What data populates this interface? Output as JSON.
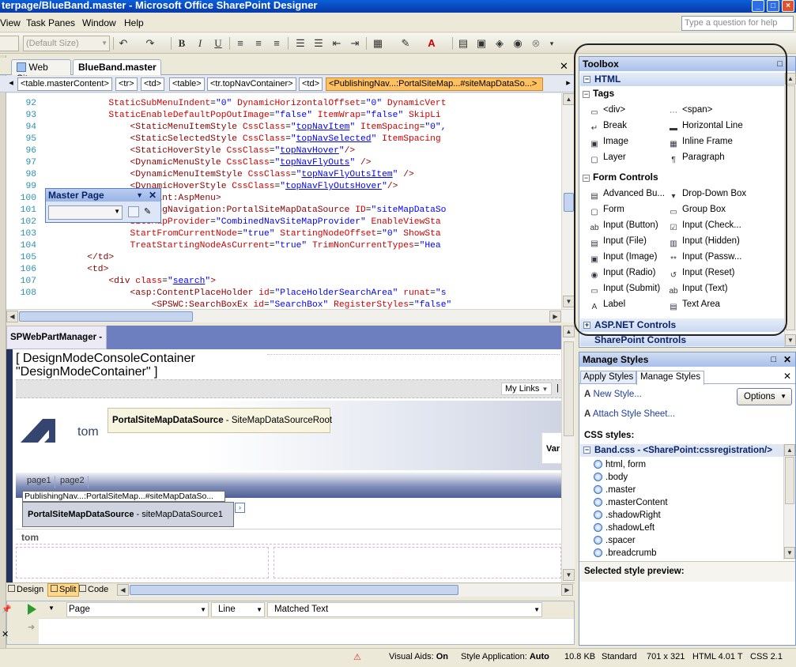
{
  "window": {
    "title": "terpage/BlueBand.master - Microsoft Office SharePoint Designer",
    "controls": [
      "minimize-icon",
      "maximize-icon",
      "close-icon"
    ]
  },
  "menu": {
    "items": [
      "View",
      "Task Panes",
      "Window",
      "Help"
    ],
    "help_placeholder": "Type a question for help"
  },
  "toolbar": {
    "font_size": "(Default Size)"
  },
  "doc_tabs": [
    "Web Site",
    "BlueBand.master"
  ],
  "breadcrumb": [
    "<table.masterContent>",
    "<tr>",
    "<td>",
    "<table>",
    "<tr.topNavContainer>",
    "<td>",
    "<PublishingNav...:PortalSiteMap...#siteMapDataSo...>"
  ],
  "code": {
    "line_numbers": [
      "92",
      "93",
      "94",
      "95",
      "96",
      "97",
      "98",
      "99",
      "100",
      "101",
      "102",
      "103",
      "104",
      "105",
      "106",
      "107",
      "108"
    ],
    "lines": [
      [
        {
          "c": "at",
          "t": "            StaticSubMenuIndent"
        },
        {
          "c": "tx",
          "t": "="
        },
        {
          "c": "vl",
          "t": "\"0\""
        },
        {
          "c": "at",
          "t": " DynamicHorizontalOffset"
        },
        {
          "c": "tx",
          "t": "="
        },
        {
          "c": "vl",
          "t": "\"0\""
        },
        {
          "c": "at",
          "t": " DynamicVert"
        }
      ],
      [
        {
          "c": "at",
          "t": "            StaticEnableDefaultPopOutImage"
        },
        {
          "c": "tx",
          "t": "="
        },
        {
          "c": "vl",
          "t": "\"false\""
        },
        {
          "c": "at",
          "t": " ItemWrap"
        },
        {
          "c": "tx",
          "t": "="
        },
        {
          "c": "vl",
          "t": "\"false\""
        },
        {
          "c": "at",
          "t": " SkipLi"
        }
      ],
      [
        {
          "c": "tg",
          "t": "                <StaticMenuItemStyle"
        },
        {
          "c": "at",
          "t": " CssClass"
        },
        {
          "c": "tx",
          "t": "="
        },
        {
          "c": "vl",
          "t": "\""
        },
        {
          "c": "st",
          "t": "topNavItem"
        },
        {
          "c": "vl",
          "t": "\""
        },
        {
          "c": "at",
          "t": " ItemSpacing"
        },
        {
          "c": "tx",
          "t": "="
        },
        {
          "c": "vl",
          "t": "\"0\","
        }
      ],
      [
        {
          "c": "tg",
          "t": "                <StaticSelectedStyle"
        },
        {
          "c": "at",
          "t": " CssClass"
        },
        {
          "c": "tx",
          "t": "="
        },
        {
          "c": "vl",
          "t": "\""
        },
        {
          "c": "st",
          "t": "topNavSelected"
        },
        {
          "c": "vl",
          "t": "\""
        },
        {
          "c": "at",
          "t": " ItemSpacing"
        }
      ],
      [
        {
          "c": "tg",
          "t": "                <StaticHoverStyle"
        },
        {
          "c": "at",
          "t": " CssClass"
        },
        {
          "c": "tx",
          "t": "="
        },
        {
          "c": "vl",
          "t": "\""
        },
        {
          "c": "st",
          "t": "topNavHover"
        },
        {
          "c": "vl",
          "t": "\""
        },
        {
          "c": "tg",
          "t": "/>"
        }
      ],
      [
        {
          "c": "tg",
          "t": "                <DynamicMenuStyle"
        },
        {
          "c": "at",
          "t": " CssClass"
        },
        {
          "c": "tx",
          "t": "="
        },
        {
          "c": "vl",
          "t": "\""
        },
        {
          "c": "st",
          "t": "topNavFlyOuts"
        },
        {
          "c": "vl",
          "t": "\""
        },
        {
          "c": "tg",
          "t": " />"
        }
      ],
      [
        {
          "c": "tg",
          "t": "                <DynamicMenuItemStyle"
        },
        {
          "c": "at",
          "t": " CssClass"
        },
        {
          "c": "tx",
          "t": "="
        },
        {
          "c": "vl",
          "t": "\""
        },
        {
          "c": "st",
          "t": "topNavFlyOutsItem"
        },
        {
          "c": "vl",
          "t": "\""
        },
        {
          "c": "tg",
          "t": " />"
        }
      ],
      [
        {
          "c": "tg",
          "t": "                <DynamicHoverStyle"
        },
        {
          "c": "at",
          "t": " CssClass"
        },
        {
          "c": "tx",
          "t": "="
        },
        {
          "c": "vl",
          "t": "\""
        },
        {
          "c": "st",
          "t": "topNavFlyOutsHover"
        },
        {
          "c": "vl",
          "t": "\""
        },
        {
          "c": "tg",
          "t": "/>"
        }
      ],
      [
        {
          "c": "tg",
          "t": "            </SharePoint:AspMenu>"
        }
      ],
      [
        {
          "c": "tg",
          "t": "            <PublishingNavigation:PortalSiteMapDataSource"
        },
        {
          "c": "at",
          "t": " ID"
        },
        {
          "c": "tx",
          "t": "="
        },
        {
          "c": "vl",
          "t": "\"siteMapDataSo"
        }
      ],
      [
        {
          "c": "at",
          "t": "                SiteMapProvider"
        },
        {
          "c": "tx",
          "t": "="
        },
        {
          "c": "vl",
          "t": "\"CombinedNavSiteMapProvider\""
        },
        {
          "c": "at",
          "t": " EnableViewSta"
        }
      ],
      [
        {
          "c": "at",
          "t": "                StartFromCurrentNode"
        },
        {
          "c": "tx",
          "t": "="
        },
        {
          "c": "vl",
          "t": "\"true\""
        },
        {
          "c": "at",
          "t": " StartingNodeOffset"
        },
        {
          "c": "tx",
          "t": "="
        },
        {
          "c": "vl",
          "t": "\"0\""
        },
        {
          "c": "at",
          "t": " ShowSta"
        }
      ],
      [
        {
          "c": "at",
          "t": "                TreatStartingNodeAsCurrent"
        },
        {
          "c": "tx",
          "t": "="
        },
        {
          "c": "vl",
          "t": "\"true\""
        },
        {
          "c": "at",
          "t": " TrimNonCurrentTypes"
        },
        {
          "c": "tx",
          "t": "="
        },
        {
          "c": "vl",
          "t": "\"Hea"
        }
      ],
      [
        {
          "c": "tg",
          "t": "        </td>"
        }
      ],
      [
        {
          "c": "tg",
          "t": "        <td>"
        }
      ],
      [
        {
          "c": "tg",
          "t": "            <div"
        },
        {
          "c": "at",
          "t": " class"
        },
        {
          "c": "tx",
          "t": "="
        },
        {
          "c": "vl",
          "t": "\""
        },
        {
          "c": "st",
          "t": "search"
        },
        {
          "c": "vl",
          "t": "\""
        },
        {
          "c": "tg",
          "t": ">"
        }
      ],
      [
        {
          "c": "tg",
          "t": "                <asp:ContentPlaceHolder"
        },
        {
          "c": "at",
          "t": " id"
        },
        {
          "c": "tx",
          "t": "="
        },
        {
          "c": "vl",
          "t": "\"PlaceHolderSearchArea\""
        },
        {
          "c": "at",
          "t": " runat"
        },
        {
          "c": "tx",
          "t": "="
        },
        {
          "c": "vl",
          "t": "\"s"
        }
      ],
      [
        {
          "c": "tg",
          "t": "                    <SPSWC:SearchBoxEx"
        },
        {
          "c": "at",
          "t": " id"
        },
        {
          "c": "tx",
          "t": "="
        },
        {
          "c": "vl",
          "t": "\"SearchBox\""
        },
        {
          "c": "at",
          "t": " RegisterStyles"
        },
        {
          "c": "tx",
          "t": "="
        },
        {
          "c": "vl",
          "t": "\"false\""
        }
      ]
    ]
  },
  "master_panel": {
    "title": "Master Page"
  },
  "design": {
    "webpartmanager": "SPWebPartManager -",
    "console_line1": "[ DesignModeConsoleContainer",
    "console_line2": "\"DesignModeContainer\" ]",
    "my_links": "My Links",
    "my_links_sep": "|",
    "sitemap_root_bold": "PortalSiteMapDataSource",
    "sitemap_root_rest": " - SiteMapDataSourceRoot",
    "logo_text": "tom",
    "va_label": "Var",
    "tabs": [
      "page1",
      "page2"
    ],
    "publishing_label": "PublishingNav...:PortalSiteMap...#siteMapDataSo...",
    "sitemap1_bold": "PortalSiteMapDataSource",
    "sitemap1_rest": " - siteMapDataSource1",
    "crumb_tom": "tom"
  },
  "view_tabs": [
    "Design",
    "Split",
    "Code"
  ],
  "find": {
    "columns": [
      "Page",
      "Line",
      "Matched Text"
    ]
  },
  "status": {
    "visual_aids_label": "Visual Aids:",
    "visual_aids_value": "On",
    "style_app_label": "Style Application:",
    "style_app_value": "Auto",
    "size": "10.8 KB",
    "mode": "Standard",
    "dimensions": "701 x 321",
    "doctype": "HTML 4.01 T",
    "css": "CSS 2.1"
  },
  "toolbox": {
    "title": "Toolbox",
    "section_html": "HTML",
    "group_tags": "Tags",
    "tags": [
      {
        "label": "<div>",
        "icon": "div-icon"
      },
      {
        "label": "<span>",
        "icon": "span-icon"
      },
      {
        "label": "Break",
        "icon": "break-icon"
      },
      {
        "label": "Horizontal Line",
        "icon": "hr-icon"
      },
      {
        "label": "Image",
        "icon": "image-icon"
      },
      {
        "label": "Inline Frame",
        "icon": "iframe-icon"
      },
      {
        "label": "Layer",
        "icon": "layer-icon"
      },
      {
        "label": "Paragraph",
        "icon": "paragraph-icon"
      }
    ],
    "group_forms": "Form Controls",
    "forms": [
      {
        "label": "Advanced Bu...",
        "icon": "advanced-button-icon"
      },
      {
        "label": "Drop-Down Box",
        "icon": "dropdown-icon"
      },
      {
        "label": "Form",
        "icon": "form-icon"
      },
      {
        "label": "Group Box",
        "icon": "groupbox-icon"
      },
      {
        "label": "Input (Button)",
        "icon": "input-button-icon"
      },
      {
        "label": "Input (Check...",
        "icon": "checkbox-icon"
      },
      {
        "label": "Input (File)",
        "icon": "input-file-icon"
      },
      {
        "label": "Input (Hidden)",
        "icon": "input-hidden-icon"
      },
      {
        "label": "Input (Image)",
        "icon": "input-image-icon"
      },
      {
        "label": "Input (Passw...",
        "icon": "password-icon"
      },
      {
        "label": "Input (Radio)",
        "icon": "radio-icon"
      },
      {
        "label": "Input (Reset)",
        "icon": "reset-icon"
      },
      {
        "label": "Input (Submit)",
        "icon": "submit-icon"
      },
      {
        "label": "Input (Text)",
        "icon": "textbox-icon"
      },
      {
        "label": "Label",
        "icon": "label-icon"
      },
      {
        "label": "Text Area",
        "icon": "textarea-icon"
      }
    ],
    "section_aspnet": "ASP.NET Controls",
    "section_sharepoint": "SharePoint Controls"
  },
  "manage_styles": {
    "title": "Manage Styles",
    "tabs": [
      "Apply Styles",
      "Manage Styles"
    ],
    "new_style": "New Style...",
    "attach": "Attach Style Sheet...",
    "options": "Options",
    "css_styles_label": "CSS styles:",
    "sheet": "Band.css - <SharePoint:cssregistration/>",
    "styles": [
      "html, form",
      ".body",
      ".master",
      ".masterContent",
      ".shadowRight",
      ".shadowLeft",
      ".spacer",
      ".breadcrumb"
    ],
    "preview_label": "Selected style preview:"
  }
}
